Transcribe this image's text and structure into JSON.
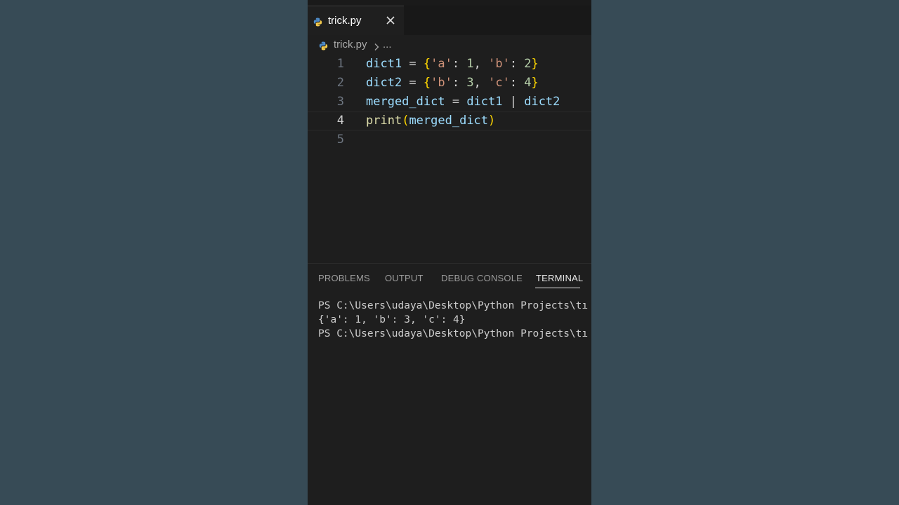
{
  "tab": {
    "icon": "python-icon",
    "label": "trick.py",
    "close_icon": "close-icon"
  },
  "breadcrumb": {
    "file": "trick.py",
    "separator_icon": "chevron-right-icon",
    "more": "..."
  },
  "editor": {
    "active_line": 4,
    "line_numbers": [
      "1",
      "2",
      "3",
      "4",
      "5"
    ],
    "lines": [
      "dict1 = {'a': 1, 'b': 2}",
      "dict2 = {'b': 3, 'c': 4}",
      "merged_dict = dict1 | dict2",
      "print(merged_dict)",
      ""
    ]
  },
  "panel": {
    "tabs": [
      "PROBLEMS",
      "OUTPUT",
      "DEBUG CONSOLE",
      "TERMINAL"
    ],
    "active_tab": "TERMINAL",
    "terminal_lines": [
      "PS C:\\Users\\udaya\\Desktop\\Python Projects\\tı",
      "{'a': 1, 'b': 3, 'c': 4}",
      "PS C:\\Users\\udaya\\Desktop\\Python Projects\\tı"
    ]
  },
  "colors": {
    "background": "#374b56",
    "editor_bg": "#1e1e1e",
    "variable": "#9cdcfe",
    "string": "#ce9178",
    "number": "#b5cea8",
    "function": "#dcdcaa",
    "bracket": "#ffd700"
  }
}
